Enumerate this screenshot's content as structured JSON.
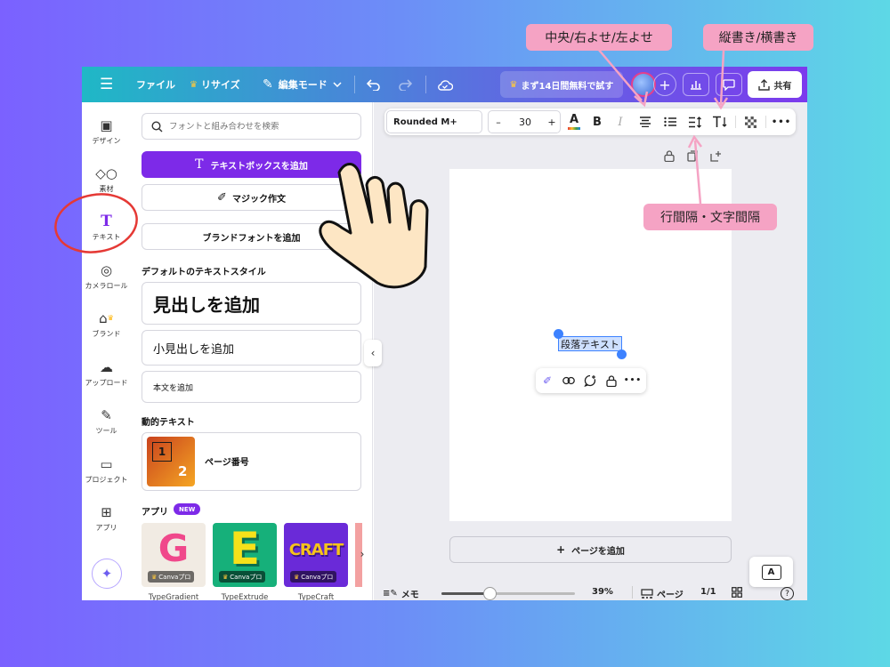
{
  "topbar": {
    "menu_icon": "hamburger-icon",
    "file": "ファイル",
    "resize": "リサイズ",
    "edit_mode": "編集モード",
    "trial": "まず14日間無料で試す",
    "share": "共有"
  },
  "rail": [
    {
      "label": "デザイン",
      "icon": "layout-icon"
    },
    {
      "label": "素材",
      "icon": "shapes-icon"
    },
    {
      "label": "テキスト",
      "icon": "text-icon"
    },
    {
      "label": "カメラロール",
      "icon": "camera-icon"
    },
    {
      "label": "ブランド",
      "icon": "brand-icon"
    },
    {
      "label": "アップロード",
      "icon": "upload-icon"
    },
    {
      "label": "ツール",
      "icon": "pen-icon"
    },
    {
      "label": "プロジェクト",
      "icon": "folder-icon"
    },
    {
      "label": "アプリ",
      "icon": "apps-icon"
    }
  ],
  "panel": {
    "search_placeholder": "フォントと組み合わせを検索",
    "add_textbox": "テキストボックスを追加",
    "magic_write": "マジック作文",
    "brand_font": "ブランドフォントを追加",
    "default_styles_header": "デフォルトのテキストスタイル",
    "heading": "見出しを追加",
    "subheading": "小見出しを追加",
    "body": "本文を追加",
    "dynamic_header": "動的テキスト",
    "page_number": "ページ番号",
    "page_number_thumb": [
      "1",
      "2"
    ],
    "apps_header": "アプリ",
    "apps_badge": "NEW",
    "apps": [
      {
        "name": "TypeGradient",
        "badge": "Canvaプロ",
        "tile_letter": "G"
      },
      {
        "name": "TypeExtrude",
        "badge": "Canvaプロ",
        "tile_letter": "E"
      },
      {
        "name": "TypeCraft",
        "badge": "Canvaプロ",
        "tile_letter": "CRAFT"
      }
    ]
  },
  "toolbar": {
    "font": "Rounded M+",
    "minus": "–",
    "size": "30",
    "plus": "+",
    "bold": "B",
    "italic": "I",
    "more": "•••"
  },
  "canvas": {
    "selected_text": "段落テキスト",
    "add_page": "ページを追加",
    "add_page_plus": "+"
  },
  "bottombar": {
    "memo": "メモ",
    "zoom": "39%",
    "pages_label": "ページ",
    "pages_count": "1/1"
  },
  "callouts": {
    "align": "中央/右よせ/左よせ",
    "vertical": "縦書き/横書き",
    "spacing": "行間隔・文字間隔"
  },
  "colors": {
    "accent": "#7d2ae8",
    "callout": "#f5a3c4",
    "annotation_circle": "#e53935"
  }
}
